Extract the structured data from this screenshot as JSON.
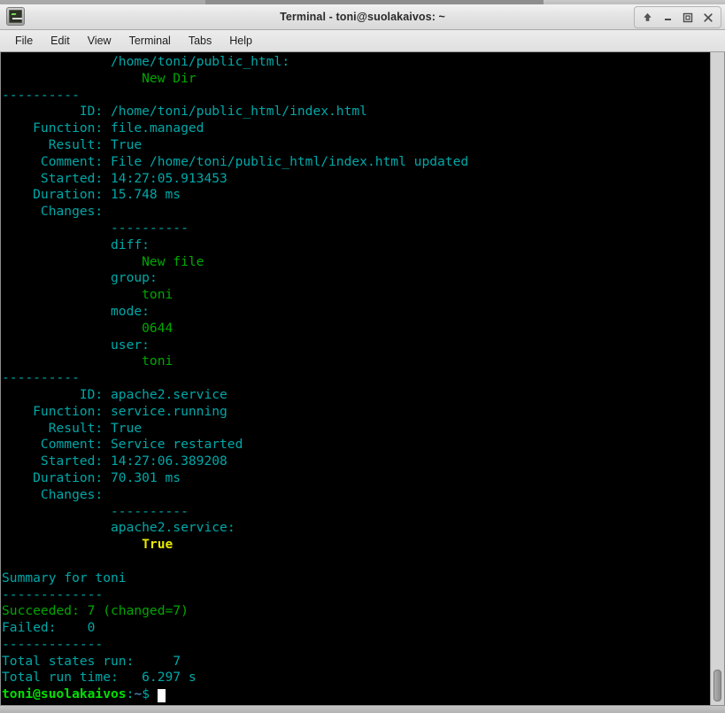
{
  "window": {
    "title": "Terminal - toni@suolakaivos: ~",
    "icon": "terminal-icon",
    "buttons": [
      {
        "name": "shade-button",
        "glyph": "shade"
      },
      {
        "name": "minimize-button",
        "glyph": "minimize"
      },
      {
        "name": "maximize-button",
        "glyph": "maximize"
      },
      {
        "name": "close-button",
        "glyph": "close"
      }
    ]
  },
  "menubar": {
    "items": [
      {
        "label": "File"
      },
      {
        "label": "Edit"
      },
      {
        "label": "View"
      },
      {
        "label": "Terminal"
      },
      {
        "label": "Tabs"
      },
      {
        "label": "Help"
      }
    ]
  },
  "colors": {
    "background": "#000000",
    "cyan": "#00a8a8",
    "green": "#00a800",
    "bright_green": "#00e000",
    "yellow": "#e8e800",
    "blue": "#5c9fe0",
    "white": "#d8d8d8"
  },
  "terminal": {
    "prompt": {
      "user_host": "toni@suolakaivos",
      "separator": ":",
      "path": "~",
      "sigil": "$",
      "cursor": "block"
    },
    "lines": [
      {
        "segments": [
          {
            "t": "              /home/toni/public_html",
            "c": "cyan"
          },
          {
            "t": ":",
            "c": "cyan"
          }
        ]
      },
      {
        "segments": [
          {
            "t": "                  New Dir",
            "c": "green"
          }
        ]
      },
      {
        "segments": [
          {
            "t": "----------",
            "c": "cyan"
          }
        ]
      },
      {
        "segments": [
          {
            "t": "          ID: /home/toni/public_html/index.html",
            "c": "cyan"
          }
        ]
      },
      {
        "segments": [
          {
            "t": "    Function: file.managed",
            "c": "cyan"
          }
        ]
      },
      {
        "segments": [
          {
            "t": "      Result: True",
            "c": "cyan"
          }
        ]
      },
      {
        "segments": [
          {
            "t": "     Comment: File /home/toni/public_html/index.html updated",
            "c": "cyan"
          }
        ]
      },
      {
        "segments": [
          {
            "t": "     Started: 14:27:05.913453",
            "c": "cyan"
          }
        ]
      },
      {
        "segments": [
          {
            "t": "    Duration: 15.748 ms",
            "c": "cyan"
          }
        ]
      },
      {
        "segments": [
          {
            "t": "     Changes:",
            "c": "cyan"
          }
        ]
      },
      {
        "segments": [
          {
            "t": "              ----------",
            "c": "cyan"
          }
        ]
      },
      {
        "segments": [
          {
            "t": "              diff",
            "c": "cyan"
          },
          {
            "t": ":",
            "c": "cyan"
          }
        ]
      },
      {
        "segments": [
          {
            "t": "                  New file",
            "c": "green"
          }
        ]
      },
      {
        "segments": [
          {
            "t": "              group",
            "c": "cyan"
          },
          {
            "t": ":",
            "c": "cyan"
          }
        ]
      },
      {
        "segments": [
          {
            "t": "                  toni",
            "c": "green"
          }
        ]
      },
      {
        "segments": [
          {
            "t": "              mode",
            "c": "cyan"
          },
          {
            "t": ":",
            "c": "cyan"
          }
        ]
      },
      {
        "segments": [
          {
            "t": "                  0644",
            "c": "green"
          }
        ]
      },
      {
        "segments": [
          {
            "t": "              user",
            "c": "cyan"
          },
          {
            "t": ":",
            "c": "cyan"
          }
        ]
      },
      {
        "segments": [
          {
            "t": "                  toni",
            "c": "green"
          }
        ]
      },
      {
        "segments": [
          {
            "t": "----------",
            "c": "cyan"
          }
        ]
      },
      {
        "segments": [
          {
            "t": "          ID: apache2.service",
            "c": "cyan"
          }
        ]
      },
      {
        "segments": [
          {
            "t": "    Function: service.running",
            "c": "cyan"
          }
        ]
      },
      {
        "segments": [
          {
            "t": "      Result: True",
            "c": "cyan"
          }
        ]
      },
      {
        "segments": [
          {
            "t": "     Comment: Service restarted",
            "c": "cyan"
          }
        ]
      },
      {
        "segments": [
          {
            "t": "     Started: 14:27:06.389208",
            "c": "cyan"
          }
        ]
      },
      {
        "segments": [
          {
            "t": "    Duration: 70.301 ms",
            "c": "cyan"
          }
        ]
      },
      {
        "segments": [
          {
            "t": "     Changes:",
            "c": "cyan"
          }
        ]
      },
      {
        "segments": [
          {
            "t": "              ----------",
            "c": "cyan"
          }
        ]
      },
      {
        "segments": [
          {
            "t": "              apache2.service",
            "c": "cyan"
          },
          {
            "t": ":",
            "c": "cyan"
          }
        ]
      },
      {
        "segments": [
          {
            "t": "                  True",
            "c": "yellow"
          }
        ]
      },
      {
        "segments": [
          {
            "t": "",
            "c": "cyan"
          }
        ]
      },
      {
        "segments": [
          {
            "t": "Summary for toni",
            "c": "cyan"
          }
        ]
      },
      {
        "segments": [
          {
            "t": "-------------",
            "c": "cyan"
          }
        ]
      },
      {
        "segments": [
          {
            "t": "Succeeded: 7 (changed=7)",
            "c": "green"
          }
        ]
      },
      {
        "segments": [
          {
            "t": "Failed:    0",
            "c": "cyan"
          }
        ]
      },
      {
        "segments": [
          {
            "t": "-------------",
            "c": "cyan"
          }
        ]
      },
      {
        "segments": [
          {
            "t": "Total states run:     7",
            "c": "cyan"
          }
        ]
      },
      {
        "segments": [
          {
            "t": "Total run time:   6.297 s",
            "c": "cyan"
          }
        ]
      }
    ]
  },
  "scrollbar": {
    "orientation": "vertical",
    "thumb_position": "bottom"
  }
}
